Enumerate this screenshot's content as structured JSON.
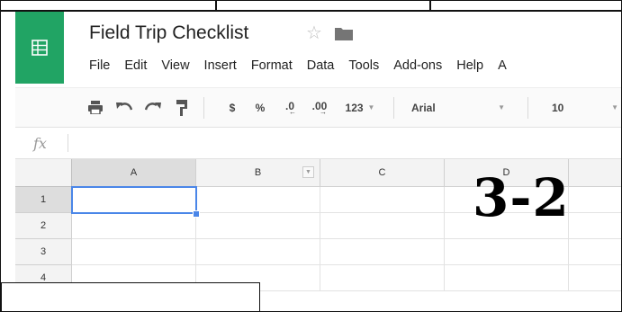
{
  "app": {
    "document_title": "Field Trip Checklist",
    "icons": {
      "logo": "sheets-logo-icon",
      "star": "star-icon",
      "folder": "folder-icon"
    }
  },
  "menu": [
    "File",
    "Edit",
    "View",
    "Insert",
    "Format",
    "Data",
    "Tools",
    "Add-ons",
    "Help",
    "A"
  ],
  "toolbar": {
    "print_icon": "print-icon",
    "undo_icon": "undo-icon",
    "redo_icon": "redo-icon",
    "paint_format_icon": "paint-format-icon",
    "currency": "$",
    "percent": "%",
    "decrease_decimals": ".0",
    "increase_decimals": ".00",
    "more_formats": "123",
    "font": "Arial",
    "font_size": "10"
  },
  "formula_bar": {
    "label": "fx",
    "value": ""
  },
  "grid": {
    "columns": [
      "A",
      "B",
      "C",
      "D"
    ],
    "rows": [
      "1",
      "2",
      "3",
      "4"
    ],
    "selected_cell": "A1"
  },
  "overlay": {
    "label": "3-2"
  },
  "colors": {
    "brand": "#21a464",
    "selection": "#4a86e8"
  }
}
